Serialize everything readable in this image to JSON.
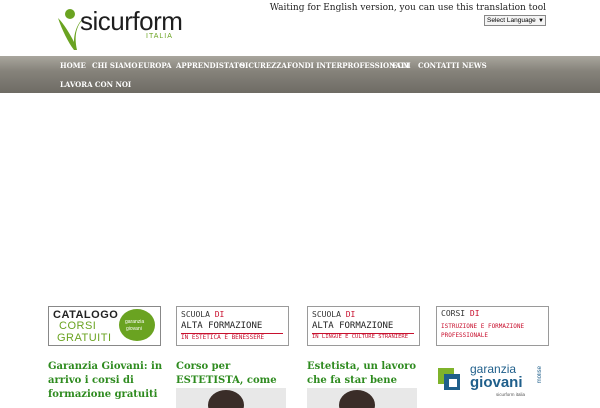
{
  "header": {
    "logo_text": "sicurform",
    "logo_sub": "ITALIA",
    "translate_note": "Waiting for English version, you can use this translation tool",
    "language_select": "Select Language"
  },
  "nav": {
    "items": [
      "HOME",
      "CHI SIAMO",
      "EUROPA",
      "APPRENDISTATO",
      "SICUREZZA",
      "FONDI INTERPROFESSIONALI",
      "ECM",
      "CONTATTI",
      "NEWS",
      "LAVORA CON NOI"
    ]
  },
  "banners": [
    {
      "line1": "CATALOGO",
      "line2": "CORSI",
      "line3": "GRATUITI",
      "badge1": "garanzia",
      "badge2": "giovani"
    },
    {
      "line1": "SCUOLA",
      "line1b": "DI",
      "line2": "ALTA FORMAZIONE",
      "line3": "IN ESTETICA E BENESSERE"
    },
    {
      "line1": "SCUOLA",
      "line1b": "DI",
      "line2": "ALTA FORMAZIONE",
      "line3": "IN LINGUE E CULTURE STRANIERE"
    },
    {
      "line1": "CORSI",
      "line1b": "DI",
      "line2": "ISTRUZIONE E FORMAZIONE",
      "line3": "PROFESSIONALE"
    }
  ],
  "articles": [
    {
      "title": "Garanzia Giovani: in arrivo i corsi di formazione gratuiti"
    },
    {
      "title": "Corso per ESTETISTA, come risparmiare"
    },
    {
      "title": "Estetista, un lavoro che fa star bene"
    },
    {
      "logo_line1": "garanzia",
      "logo_line2": "giovani",
      "logo_side": "molise",
      "logo_sub": "sicurform italia"
    }
  ],
  "colors": {
    "brand_green": "#6aa321",
    "title_green": "#2e8b1f",
    "nav_gray": "#86837b"
  }
}
